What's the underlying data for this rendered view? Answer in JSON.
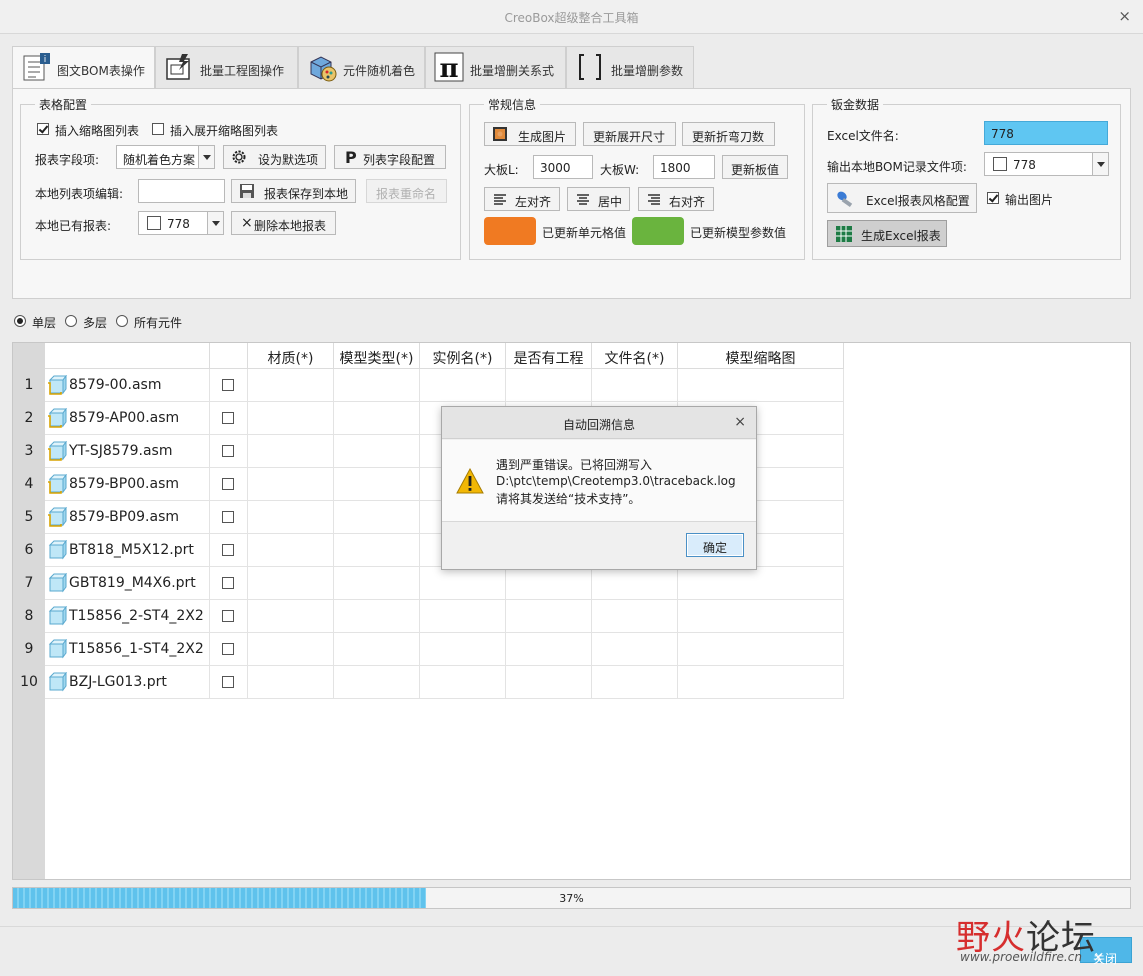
{
  "window": {
    "title": "CreoBox超级整合工具箱",
    "close_glyph": "×"
  },
  "tabs": [
    {
      "label": "图文BOM表操作",
      "icon": "bom-table-icon",
      "active": true
    },
    {
      "label": "批量工程图操作",
      "icon": "drawing-batch-icon",
      "active": false
    },
    {
      "label": "元件随机着色",
      "icon": "random-color-icon",
      "active": false
    },
    {
      "label": "批量增删关系式",
      "icon": "pi-relation-icon",
      "active": false
    },
    {
      "label": "批量增删参数",
      "icon": "bracket-param-icon",
      "active": false
    }
  ],
  "table_config": {
    "title": "表格配置",
    "insert_thumb": {
      "label": "插入缩略图列表",
      "checked": true
    },
    "insert_expand_thumb": {
      "label": "插入展开缩略图列表",
      "checked": false
    },
    "field_label": "报表字段项:",
    "field_value": "随机着色方案",
    "set_default_btn": "设为默选项",
    "list_field_btn": "列表字段配置",
    "local_edit_label": "本地列表项编辑:",
    "local_edit_value": "",
    "save_local_btn": "报表保存到本地",
    "rename_btn": "报表重命名",
    "local_have_label": "本地已有报表:",
    "local_have_value": "778",
    "delete_btn": "删除本地报表"
  },
  "general_info": {
    "title": "常规信息",
    "gen_image_btn": "生成图片",
    "update_expand_btn": "更新展开尺寸",
    "update_bend_btn": "更新折弯刀数",
    "board_l_label": "大板L:",
    "board_l_value": "3000",
    "board_w_label": "大板W:",
    "board_w_value": "1800",
    "update_board_btn": "更新板值",
    "align_left_btn": "左对齐",
    "align_center_btn": "居中",
    "align_right_btn": "右对齐",
    "legend_updated_cell": "已更新单元格值",
    "legend_updated_model": "已更新模型参数值",
    "color_orange": "#f07a22",
    "color_green": "#6ab43e"
  },
  "sheet_metal": {
    "title": "钣金数据",
    "excel_name_label": "Excel文件名:",
    "excel_name_value": "778",
    "output_bom_label": "输出本地BOM记录文件项:",
    "output_bom_value": "778",
    "excel_style_btn": "Excel报表风格配置",
    "output_image": {
      "label": "输出图片",
      "checked": true
    },
    "gen_excel_btn": "生成Excel报表",
    "highlight_color": "#5fc6f2"
  },
  "level_options": [
    {
      "label": "单层",
      "selected": true
    },
    {
      "label": "多层",
      "selected": false
    },
    {
      "label": "所有元件",
      "selected": false
    }
  ],
  "grid": {
    "headers": [
      "",
      "",
      "材质(*)",
      "模型类型(*)",
      "实例名(*)",
      "是否有工程",
      "文件名(*)",
      "模型缩略图"
    ],
    "rows": [
      {
        "num": "1",
        "name": "8579-00.asm",
        "type": "asm"
      },
      {
        "num": "2",
        "name": "8579-AP00.asm",
        "type": "asm"
      },
      {
        "num": "3",
        "name": "YT-SJ8579.asm",
        "type": "asm"
      },
      {
        "num": "4",
        "name": "8579-BP00.asm",
        "type": "asm"
      },
      {
        "num": "5",
        "name": "8579-BP09.asm",
        "type": "asm"
      },
      {
        "num": "6",
        "name": "BT818_M5X12.prt",
        "type": "prt"
      },
      {
        "num": "7",
        "name": "GBT819_M4X6.prt",
        "type": "prt"
      },
      {
        "num": "8",
        "name": "T15856_2-ST4_2X2",
        "type": "prt"
      },
      {
        "num": "9",
        "name": "T15856_1-ST4_2X2",
        "type": "prt"
      },
      {
        "num": "10",
        "name": "BZJ-LG013.prt",
        "type": "prt"
      }
    ]
  },
  "progress": {
    "percent": 37,
    "label": "37%"
  },
  "footer": {
    "close_btn": "关闭",
    "close_glyph": "×"
  },
  "dialog": {
    "title": "自动回溯信息",
    "close_glyph": "×",
    "lines": [
      "遇到严重错误。已将回溯写入",
      "D:\\ptc\\temp\\Creotemp3.0\\traceback.log",
      "请将其发送给“技术支持”。"
    ],
    "ok_btn": "确定"
  },
  "watermark": {
    "main_a": "野火",
    "main_b": "论坛",
    "url": "www.proewildfire.cn"
  }
}
